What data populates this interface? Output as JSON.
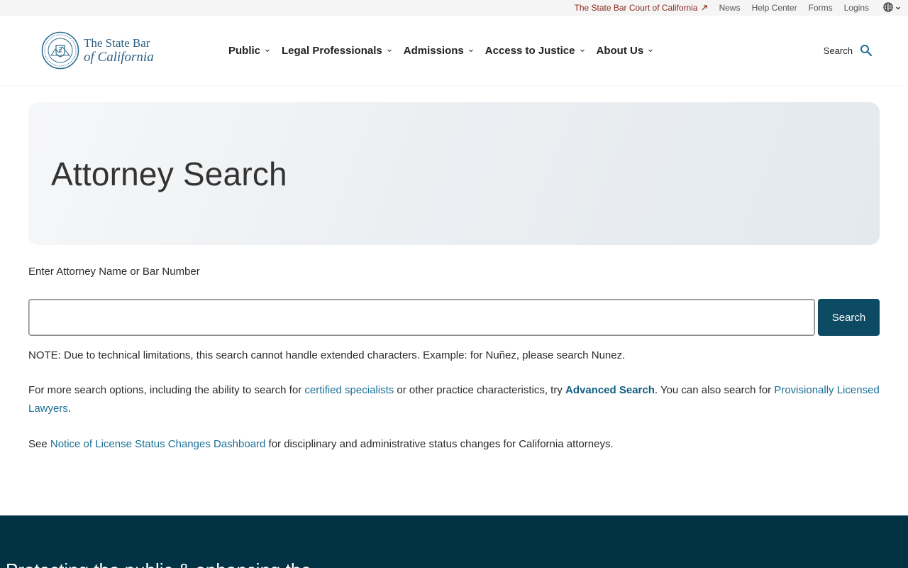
{
  "utility": {
    "court_link": "The State Bar Court of California",
    "news": "News",
    "help_center": "Help Center",
    "forms": "Forms",
    "logins": "Logins"
  },
  "logo": {
    "line1": "The State Bar",
    "line2": "of California"
  },
  "nav": {
    "items": [
      {
        "label": "Public"
      },
      {
        "label": "Legal Professionals"
      },
      {
        "label": "Admissions"
      },
      {
        "label": "Access to Justice"
      },
      {
        "label": "About Us"
      }
    ]
  },
  "header_search": {
    "label": "Search"
  },
  "hero": {
    "title": "Attorney Search"
  },
  "search": {
    "label": "Enter Attorney Name or Bar Number",
    "value": "",
    "button": "Search"
  },
  "content": {
    "note": "NOTE: Due to technical limitations, this search cannot handle extended characters. Example: for Nuñez, please search Nunez.",
    "more_1": "For more search options, including the ability to search for ",
    "certified_specialists": "certified specialists",
    "more_2": " or other practice characteristics, try ",
    "advanced_search": "Advanced Search",
    "more_3": ". You can also search for ",
    "provisionally_licensed": "Provisionally Licensed Lawyers",
    "more_4": ".",
    "see_1": "See ",
    "dashboard_link": "Notice of License Status Changes Dashboard",
    "see_2": " for disciplinary and administrative status changes for California attorneys."
  },
  "footer": {
    "tagline": "Protecting the public & enhancing the"
  },
  "colors": {
    "primary": "#0d4a63",
    "link": "#1b6f96",
    "footer_bg": "#013345",
    "court_link": "#8a2a1e",
    "logo": "#2d5f82"
  }
}
